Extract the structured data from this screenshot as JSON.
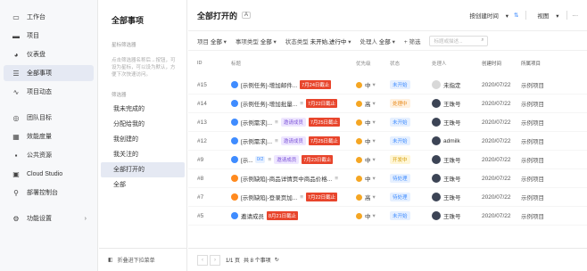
{
  "nav": {
    "items": [
      {
        "icon": "inbox-icon",
        "glyph": "▭",
        "label": "工作台"
      },
      {
        "icon": "folder-icon",
        "glyph": "▬",
        "label": "项目"
      },
      {
        "icon": "dashboard-icon",
        "glyph": "◕",
        "label": "仪表盘"
      },
      {
        "icon": "list-icon",
        "glyph": "☰",
        "label": "全部事项",
        "active": true
      },
      {
        "icon": "activity-icon",
        "glyph": "∿",
        "label": "项目动态"
      }
    ],
    "items2": [
      {
        "icon": "target-icon",
        "glyph": "◎",
        "label": "团队目标"
      },
      {
        "icon": "chart-icon",
        "glyph": "▦",
        "label": "效能度量"
      },
      {
        "icon": "grid-icon",
        "glyph": "▪",
        "label": "公共资源"
      },
      {
        "icon": "cloud-studio-icon",
        "glyph": "▣",
        "label": "Cloud Studio"
      },
      {
        "icon": "deploy-icon",
        "glyph": "⚲",
        "label": "部署控制台"
      }
    ],
    "settings": {
      "icon": "settings-icon",
      "glyph": "⚙",
      "label": "功能设置",
      "chev": "›"
    }
  },
  "mid": {
    "title": "全部事项",
    "sec1": "星标筛选器",
    "note": "点击筛选器名称后→按钮，可设为星标，可以设为默认，方便下次快速访问。",
    "sec2": "筛选器",
    "filters": [
      "我未完成的",
      "分配给我的",
      "我创建的",
      "我关注的",
      "全部打开的",
      "全部"
    ],
    "active_index": 4,
    "footer": "折叠进下拉菜单",
    "footer_glyph": "◧"
  },
  "main": {
    "title": "全部打开的",
    "tag": "A",
    "sort": "按创建时间",
    "sort_glyph": "▾",
    "sort_icon": "⇅",
    "view": "视图",
    "more": "···",
    "filters": [
      {
        "key": "项目",
        "val": "全部"
      },
      {
        "key": "事项类型",
        "val": "全部"
      },
      {
        "key": "状态类型",
        "val": "未开始,进行中"
      },
      {
        "key": "处理人",
        "val": "全部"
      }
    ],
    "add_filter": "+ 筛选",
    "search_placeholder": "标题或描述...",
    "columns": [
      "ID",
      "标题",
      "优先级",
      "状态",
      "处理人",
      "创建时间",
      "所属项目"
    ]
  },
  "rows": [
    {
      "id": "#15",
      "type": "task",
      "title": "[示例任务]-增加邮件...",
      "due": "7月24日截止",
      "invite": "",
      "sub": "",
      "lines": "",
      "pri": "中",
      "status": "未开始",
      "status_cls": "st-blue",
      "handler": "未指定",
      "av": "av-gray",
      "date": "2020/07/22",
      "proj": "示例项目"
    },
    {
      "id": "#14",
      "type": "task",
      "title": "[示例任务]-增加批量...",
      "due": "7月22日截止",
      "invite": "",
      "sub": "",
      "lines": "≡",
      "pri": "高",
      "status": "处理中",
      "status_cls": "st-orange",
      "handler": "王珠号",
      "av": "av-dark",
      "date": "2020/07/22",
      "proj": "示例项目"
    },
    {
      "id": "#13",
      "type": "req",
      "title": "[示例需求]...",
      "due": "7月25日截止",
      "invite": "邀请成员",
      "sub": "",
      "lines": "≡",
      "pri": "中",
      "status": "未开始",
      "status_cls": "st-blue",
      "handler": "王珠号",
      "av": "av-dark",
      "date": "2020/07/22",
      "proj": "示例项目"
    },
    {
      "id": "#12",
      "type": "req",
      "title": "[示例需求]...",
      "due": "7月25日截止",
      "invite": "邀请成员",
      "sub": "",
      "lines": "≡",
      "pri": "中",
      "status": "未开始",
      "status_cls": "st-blue",
      "handler": "admilk",
      "av": "av-dark",
      "date": "2020/07/22",
      "proj": "示例项目"
    },
    {
      "id": "#9",
      "type": "req",
      "title": "[示...",
      "due": "7月23日截止",
      "invite": "邀请成员",
      "sub": "0/2",
      "lines": "≡",
      "pri": "中",
      "status": "开发中",
      "status_cls": "st-yellow",
      "handler": "王珠号",
      "av": "av-dark",
      "date": "2020/07/22",
      "proj": "示例项目"
    },
    {
      "id": "#8",
      "type": "bug",
      "title": "[示例缺陷]-商品详情页中商品价格...",
      "due": "",
      "invite": "",
      "sub": "",
      "lines": "≡",
      "pri": "中",
      "status": "待处理",
      "status_cls": "st-blue",
      "handler": "王珠号",
      "av": "av-dark",
      "date": "2020/07/22",
      "proj": "示例项目"
    },
    {
      "id": "#7",
      "type": "bug",
      "title": "[示例缺陷]-登录页加...",
      "due": "7月22日截止",
      "invite": "",
      "sub": "",
      "lines": "≡",
      "pri": "高",
      "status": "待处理",
      "status_cls": "st-blue",
      "handler": "王珠号",
      "av": "av-dark",
      "date": "2020/07/22",
      "proj": "示例项目"
    },
    {
      "id": "#5",
      "type": "task",
      "title": "邀请成员",
      "due": "8月21日截止",
      "invite": "",
      "sub": "",
      "lines": "",
      "pri": "中",
      "status": "未开始",
      "status_cls": "st-blue",
      "handler": "王珠号",
      "av": "av-dark",
      "date": "2020/07/22",
      "proj": "示例项目"
    }
  ],
  "pager": {
    "prev": "‹",
    "next": "›",
    "page": "1/1 页",
    "total": "共 8 个事项",
    "refresh": "↻"
  }
}
